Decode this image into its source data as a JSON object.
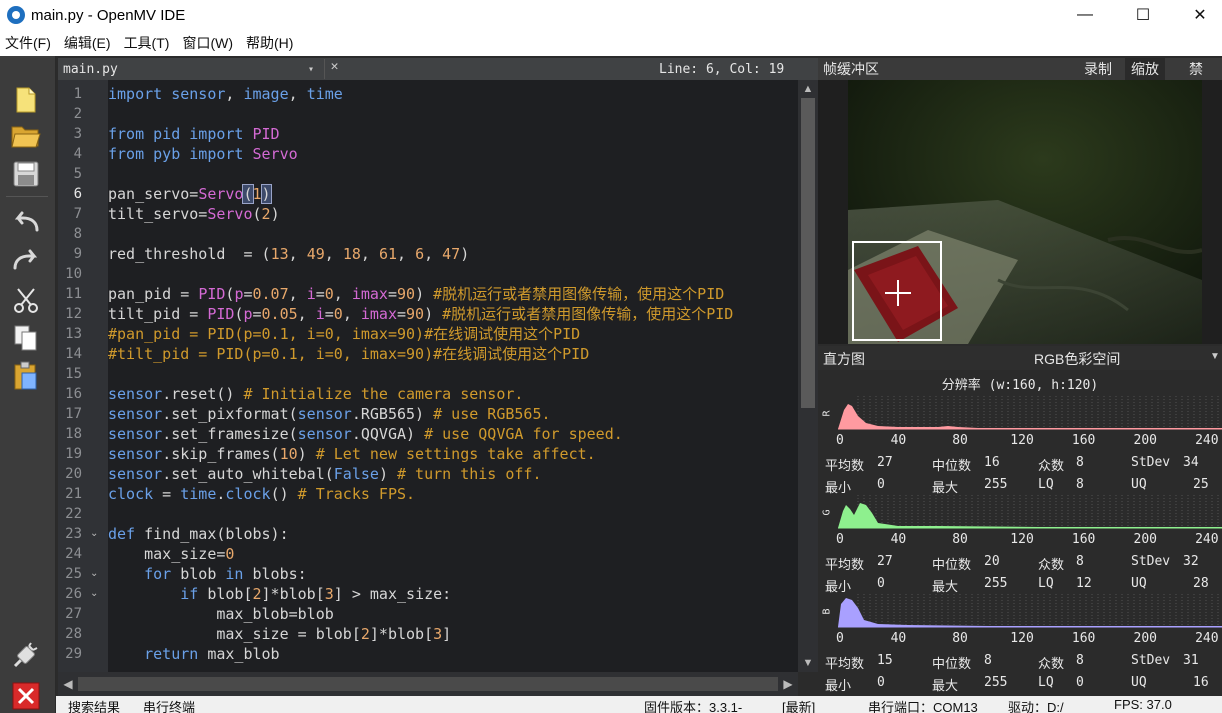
{
  "window": {
    "title": "main.py - OpenMV IDE",
    "minimize": "—",
    "maximize": "☐",
    "close": "✕"
  },
  "menu": [
    "文件(F)",
    "编辑(E)",
    "工具(T)",
    "窗口(W)",
    "帮助(H)"
  ],
  "editor": {
    "tab_file": "main.py",
    "tab_dropdown": "▾",
    "tab_close": "✕",
    "cursor_pos": "Line: 6, Col: 19",
    "line_numbers": [
      "1",
      "2",
      "3",
      "4",
      "5",
      "6",
      "7",
      "8",
      "9",
      "10",
      "11",
      "12",
      "13",
      "14",
      "15",
      "16",
      "17",
      "18",
      "19",
      "20",
      "21",
      "22",
      "23",
      "24",
      "25",
      "26",
      "27",
      "28",
      "29"
    ],
    "code_lines": [
      "import sensor, image, time",
      "",
      "from pid import PID",
      "from pyb import Servo",
      "",
      "pan_servo=Servo(1)",
      "tilt_servo=Servo(2)",
      "",
      "red_threshold  = (13, 49, 18, 61, 6, 47)",
      "",
      "pan_pid = PID(p=0.07, i=0, imax=90) #脱机运行或者禁用图像传输，使用这个PID",
      "tilt_pid = PID(p=0.05, i=0, imax=90) #脱机运行或者禁用图像传输，使用这个PID",
      "#pan_pid = PID(p=0.1, i=0, imax=90)#在线调试使用这个PID",
      "#tilt_pid = PID(p=0.1, i=0, imax=90)#在线调试使用这个PID",
      "",
      "sensor.reset() # Initialize the camera sensor.",
      "sensor.set_pixformat(sensor.RGB565) # use RGB565.",
      "sensor.set_framesize(sensor.QQVGA) # use QQVGA for speed.",
      "sensor.skip_frames(10) # Let new settings take affect.",
      "sensor.set_auto_whitebal(False) # turn this off.",
      "clock = time.clock() # Tracks FPS.",
      "",
      "def find_max(blobs):",
      "    max_size=0",
      "    for blob in blobs:",
      "        if blob[2]*blob[3] > max_size:",
      "            max_blob=blob",
      "            max_size = blob[2]*blob[3]",
      "    return max_blob"
    ]
  },
  "toolbar": {
    "items": [
      "new-file",
      "open-file",
      "save-file",
      "undo",
      "redo",
      "cut",
      "copy",
      "paste",
      "connect",
      "stop"
    ]
  },
  "framebuffer": {
    "title": "帧缓冲区",
    "record": "录制",
    "zoom": "缩放",
    "disable": "禁用"
  },
  "histogram": {
    "title": "直方图",
    "color_space": "RGB色彩空间",
    "resolution": "分辨率 (w:160, h:120)",
    "ticks": [
      "0",
      "40",
      "80",
      "120",
      "160",
      "200",
      "240"
    ],
    "channels": [
      {
        "label": "R",
        "color": "#ff9aa0",
        "mean_label": "平均数",
        "mean": "27",
        "median_label": "中位数",
        "median": "16",
        "mode_label": "众数",
        "mode": "8",
        "stdev_label": "StDev",
        "stdev": "34",
        "min_label": "最小",
        "min": "0",
        "max_label": "最大",
        "max": "255",
        "lq_label": "LQ",
        "lq": "8",
        "uq_label": "UQ",
        "uq": "25"
      },
      {
        "label": "G",
        "color": "#8ef08e",
        "mean_label": "平均数",
        "mean": "27",
        "median_label": "中位数",
        "median": "20",
        "mode_label": "众数",
        "mode": "8",
        "stdev_label": "StDev",
        "stdev": "32",
        "min_label": "最小",
        "min": "0",
        "max_label": "最大",
        "max": "255",
        "lq_label": "LQ",
        "lq": "12",
        "uq_label": "UQ",
        "uq": "28"
      },
      {
        "label": "B",
        "color": "#a9a0ff",
        "mean_label": "平均数",
        "mean": "15",
        "median_label": "中位数",
        "median": "8",
        "mode_label": "众数",
        "mode": "8",
        "stdev_label": "StDev",
        "stdev": "31",
        "min_label": "最小",
        "min": "0",
        "max_label": "最大",
        "max": "255",
        "lq_label": "LQ",
        "lq": "0",
        "uq_label": "UQ",
        "uq": "16"
      }
    ]
  },
  "status": {
    "search": "搜索结果",
    "serial": "串行终端",
    "firmware": "固件版本：3.3.1-",
    "latest": "[最新]",
    "port": "串行端口：COM13",
    "drive": "驱动：D:/",
    "fps": "FPS: 37.0"
  }
}
